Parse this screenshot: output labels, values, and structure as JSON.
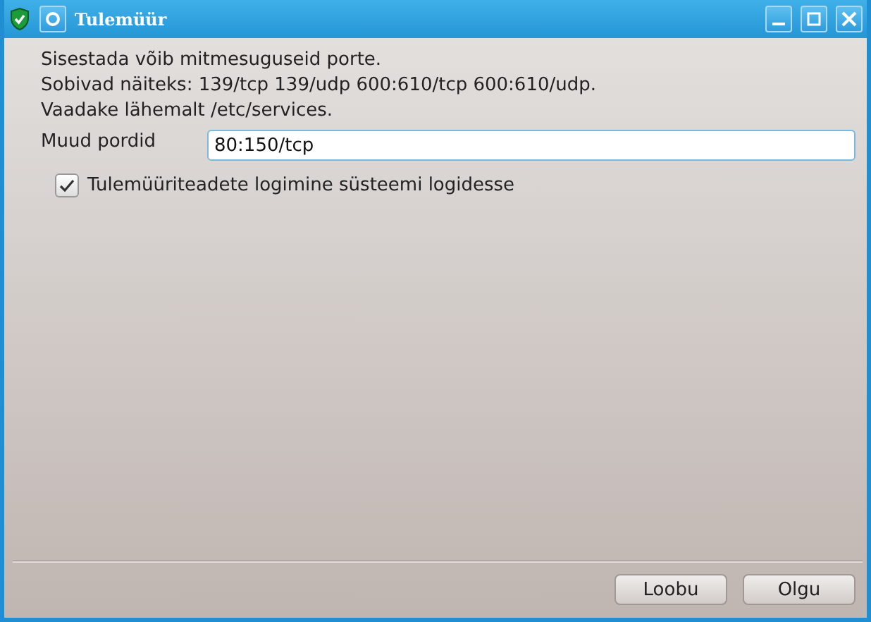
{
  "window": {
    "title": "Tulemüür"
  },
  "description": [
    "Sisestada võib mitmesuguseid porte.",
    "Sobivad näiteks: 139/tcp 139/udp 600:610/tcp 600:610/udp.",
    "Vaadake lähemalt /etc/services."
  ],
  "ports": {
    "label": "Muud pordid",
    "value": "80:150/tcp"
  },
  "log_checkbox": {
    "label": "Tulemüüriteadete logimine süsteemi logidesse",
    "checked": true
  },
  "buttons": [
    "Loobu",
    "Olgu"
  ]
}
